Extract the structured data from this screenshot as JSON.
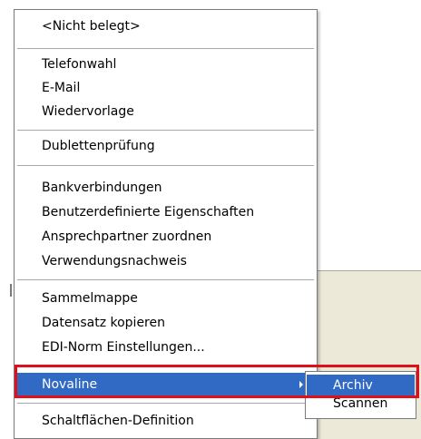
{
  "context_menu": {
    "items": [
      {
        "label": "<Nicht belegt>"
      },
      {
        "label": "Telefonwahl"
      },
      {
        "label": "E-Mail"
      },
      {
        "label": "Wiedervorlage"
      },
      {
        "label": "Dublettenprüfung"
      },
      {
        "label": "Bankverbindungen"
      },
      {
        "label": "Benutzerdefinierte Eigenschaften"
      },
      {
        "label": "Ansprechpartner zuordnen"
      },
      {
        "label": "Verwendungsnachweis"
      },
      {
        "label": "Sammelmappe"
      },
      {
        "label": "Datensatz kopieren"
      },
      {
        "label": "EDI-Norm Einstellungen..."
      },
      {
        "label": "Novaline",
        "has_submenu": true,
        "highlighted": true
      },
      {
        "label": "Schaltflächen-Definition"
      }
    ]
  },
  "submenu": {
    "items": [
      {
        "label": "Archiv",
        "highlighted": true
      },
      {
        "label": "Scannen"
      }
    ]
  },
  "colors": {
    "highlight_bg": "#316ac5",
    "annotation_box": "#e0101a",
    "menu_border": "#7a7a7a"
  },
  "icons": {
    "submenu_arrow": "triangle-right"
  }
}
